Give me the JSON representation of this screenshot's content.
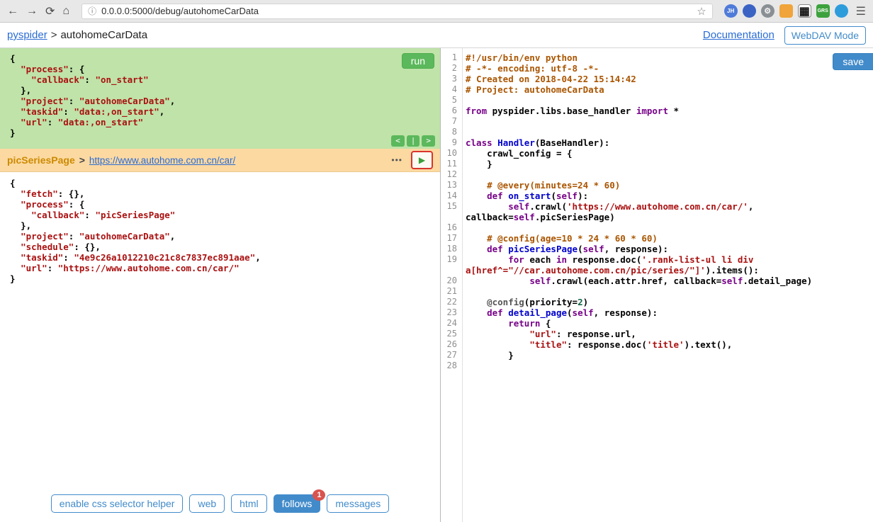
{
  "colors": {
    "accent": "#428bca",
    "link": "#2a6cd5",
    "run": "#5cb85c",
    "badge": "#d9534f",
    "play_border": "#d9342c",
    "play_fill": "#3c9e3c",
    "task_bg": "#bfe3a9",
    "follow_bg": "#fcd9a1",
    "follow_fg": "#cc8a00",
    "syn_comment": "#aa5500",
    "syn_keyword": "#770088",
    "syn_def": "#0000cc",
    "syn_string": "#aa1111",
    "syn_number": "#116644",
    "syn_meta": "#555555"
  },
  "browser": {
    "icons": {
      "back": "←",
      "forward": "→",
      "refresh": "⟳",
      "home": "⌂",
      "info": "ⓘ",
      "star": "☆",
      "menu": "☰"
    },
    "url": "0.0.0.0:5000/debug/autohomeCarData",
    "extensions": [
      {
        "name": "jh",
        "label": "JH",
        "color": "#4f7bd9",
        "shape": "circle"
      },
      {
        "name": "blue-app",
        "label": "",
        "color": "#3b63c4",
        "shape": "circle"
      },
      {
        "name": "gear",
        "label": "⚙",
        "color": "#8a8f94",
        "fg": "#f2f2f2",
        "size": "11px",
        "shape": "circle"
      },
      {
        "name": "orange-app",
        "label": "",
        "color": "#f0a43b",
        "shape": "square"
      },
      {
        "name": "qr-code",
        "label": "▦",
        "color": "#ffffff",
        "fg": "#111111",
        "size": "16px",
        "border": "1px solid #888",
        "shape": "square"
      },
      {
        "name": "grs",
        "label": "GRS",
        "color": "#3da23d",
        "size": "7px",
        "shape": "square"
      },
      {
        "name": "globe",
        "label": "",
        "color": "#2d9cdb",
        "shape": "circle"
      }
    ]
  },
  "header": {
    "app": "pyspider",
    "separator": ">",
    "project": "autohomeCarData",
    "documentation": "Documentation",
    "webdav": "WebDAV Mode"
  },
  "left": {
    "run_label": "run",
    "nav": [
      "<",
      "|",
      ">"
    ],
    "task_json": [
      [
        [
          "p",
          "{"
        ]
      ],
      [
        [
          "p",
          "  "
        ],
        [
          "s",
          "\"process\""
        ],
        [
          "p",
          ": {"
        ]
      ],
      [
        [
          "p",
          "    "
        ],
        [
          "s",
          "\"callback\""
        ],
        [
          "p",
          ": "
        ],
        [
          "s",
          "\"on_start\""
        ]
      ],
      [
        [
          "p",
          "  },"
        ]
      ],
      [
        [
          "p",
          "  "
        ],
        [
          "s",
          "\"project\""
        ],
        [
          "p",
          ": "
        ],
        [
          "s",
          "\"autohomeCarData\""
        ],
        [
          "p",
          ","
        ]
      ],
      [
        [
          "p",
          "  "
        ],
        [
          "s",
          "\"taskid\""
        ],
        [
          "p",
          ": "
        ],
        [
          "s",
          "\"data:,on_start\""
        ],
        [
          "p",
          ","
        ]
      ],
      [
        [
          "p",
          "  "
        ],
        [
          "s",
          "\"url\""
        ],
        [
          "p",
          ": "
        ],
        [
          "s",
          "\"data:,on_start\""
        ]
      ],
      [
        [
          "p",
          "}"
        ]
      ]
    ],
    "follow": {
      "callback": "picSeriesPage",
      "separator": ">",
      "url": "https://www.autohome.com.cn/car/",
      "more_label": "•••",
      "play_icon": "▶"
    },
    "detail_json": [
      [
        [
          "p",
          "{"
        ]
      ],
      [
        [
          "p",
          "  "
        ],
        [
          "s",
          "\"fetch\""
        ],
        [
          "p",
          ": {},"
        ]
      ],
      [
        [
          "p",
          "  "
        ],
        [
          "s",
          "\"process\""
        ],
        [
          "p",
          ": {"
        ]
      ],
      [
        [
          "p",
          "    "
        ],
        [
          "s",
          "\"callback\""
        ],
        [
          "p",
          ": "
        ],
        [
          "s",
          "\"picSeriesPage\""
        ]
      ],
      [
        [
          "p",
          "  },"
        ]
      ],
      [
        [
          "p",
          "  "
        ],
        [
          "s",
          "\"project\""
        ],
        [
          "p",
          ": "
        ],
        [
          "s",
          "\"autohomeCarData\""
        ],
        [
          "p",
          ","
        ]
      ],
      [
        [
          "p",
          "  "
        ],
        [
          "s",
          "\"schedule\""
        ],
        [
          "p",
          ": {},"
        ]
      ],
      [
        [
          "p",
          "  "
        ],
        [
          "s",
          "\"taskid\""
        ],
        [
          "p",
          ": "
        ],
        [
          "s",
          "\"4e9c26a1012210c21c8c7837ec891aae\""
        ],
        [
          "p",
          ","
        ]
      ],
      [
        [
          "p",
          "  "
        ],
        [
          "s",
          "\"url\""
        ],
        [
          "p",
          ": "
        ],
        [
          "s",
          "\"https://www.autohome.com.cn/car/\""
        ]
      ],
      [
        [
          "p",
          "}"
        ]
      ]
    ],
    "tabs": [
      {
        "name": "css-selector-helper",
        "label": "enable css selector helper"
      },
      {
        "name": "web",
        "label": "web"
      },
      {
        "name": "html",
        "label": "html"
      },
      {
        "name": "follows",
        "label": "follows",
        "active": true,
        "badge": "1"
      },
      {
        "name": "messages",
        "label": "messages"
      }
    ]
  },
  "editor": {
    "save_label": "save",
    "lines": [
      {
        "n": 1,
        "t": [
          [
            "c",
            "#!/usr/bin/env python"
          ]
        ]
      },
      {
        "n": 2,
        "t": [
          [
            "c",
            "# -*- encoding: utf-8 -*-"
          ]
        ]
      },
      {
        "n": 3,
        "t": [
          [
            "c",
            "# Created on 2018-04-22 15:14:42"
          ]
        ]
      },
      {
        "n": 4,
        "t": [
          [
            "c",
            "# Project: autohomeCarData"
          ]
        ]
      },
      {
        "n": 5,
        "t": []
      },
      {
        "n": 6,
        "t": [
          [
            "k",
            "from"
          ],
          [
            "p",
            " pyspider.libs.base_handler "
          ],
          [
            "k",
            "import"
          ],
          [
            "p",
            " *"
          ]
        ]
      },
      {
        "n": 7,
        "t": []
      },
      {
        "n": 8,
        "t": []
      },
      {
        "n": 9,
        "t": [
          [
            "k",
            "class"
          ],
          [
            "p",
            " "
          ],
          [
            "d",
            "Handler"
          ],
          [
            "p",
            "(BaseHandler):"
          ]
        ]
      },
      {
        "n": 10,
        "t": [
          [
            "p",
            "    crawl_config = {"
          ]
        ]
      },
      {
        "n": 11,
        "t": [
          [
            "p",
            "    }"
          ]
        ]
      },
      {
        "n": 12,
        "t": []
      },
      {
        "n": 13,
        "t": [
          [
            "c",
            "    # @every(minutes=24 * 60)"
          ]
        ]
      },
      {
        "n": 14,
        "t": [
          [
            "p",
            "    "
          ],
          [
            "k",
            "def"
          ],
          [
            "p",
            " "
          ],
          [
            "d",
            "on_start"
          ],
          [
            "p",
            "("
          ],
          [
            "k",
            "self"
          ],
          [
            "p",
            "):"
          ]
        ]
      },
      {
        "n": 15,
        "t": [
          [
            "p",
            "        "
          ],
          [
            "k",
            "self"
          ],
          [
            "p",
            ".crawl("
          ],
          [
            "s",
            "'https://www.autohome.com.cn/car/'"
          ],
          [
            "p",
            ", callback="
          ],
          [
            "k",
            "self"
          ],
          [
            "p",
            ".picSeriesPage)"
          ]
        ]
      },
      {
        "n": 16,
        "t": []
      },
      {
        "n": 17,
        "t": [
          [
            "c",
            "    # @config(age=10 * 24 * 60 * 60)"
          ]
        ]
      },
      {
        "n": 18,
        "t": [
          [
            "p",
            "    "
          ],
          [
            "k",
            "def"
          ],
          [
            "p",
            " "
          ],
          [
            "d",
            "picSeriesPage"
          ],
          [
            "p",
            "("
          ],
          [
            "k",
            "self"
          ],
          [
            "p",
            ", response):"
          ]
        ]
      },
      {
        "n": 19,
        "t": [
          [
            "p",
            "        "
          ],
          [
            "k",
            "for"
          ],
          [
            "p",
            " each "
          ],
          [
            "k",
            "in"
          ],
          [
            "p",
            " response.doc("
          ],
          [
            "s",
            "'.rank-list-ul li div a[href^=\"//car.autohome.com.cn/pic/series/\"]'"
          ],
          [
            "p",
            ").items():"
          ]
        ]
      },
      {
        "n": 20,
        "t": [
          [
            "p",
            "            "
          ],
          [
            "k",
            "self"
          ],
          [
            "p",
            ".crawl(each.attr.href, callback="
          ],
          [
            "k",
            "self"
          ],
          [
            "p",
            ".detail_page)"
          ]
        ]
      },
      {
        "n": 21,
        "t": []
      },
      {
        "n": 22,
        "t": [
          [
            "p",
            "    "
          ],
          [
            "m",
            "@config"
          ],
          [
            "p",
            "(priority="
          ],
          [
            "n",
            "2"
          ],
          [
            "p",
            ")"
          ]
        ]
      },
      {
        "n": 23,
        "t": [
          [
            "p",
            "    "
          ],
          [
            "k",
            "def"
          ],
          [
            "p",
            " "
          ],
          [
            "d",
            "detail_page"
          ],
          [
            "p",
            "("
          ],
          [
            "k",
            "self"
          ],
          [
            "p",
            ", response):"
          ]
        ]
      },
      {
        "n": 24,
        "t": [
          [
            "p",
            "        "
          ],
          [
            "k",
            "return"
          ],
          [
            "p",
            " {"
          ]
        ]
      },
      {
        "n": 25,
        "t": [
          [
            "p",
            "            "
          ],
          [
            "s",
            "\"url\""
          ],
          [
            "p",
            ": response.url,"
          ]
        ]
      },
      {
        "n": 26,
        "t": [
          [
            "p",
            "            "
          ],
          [
            "s",
            "\"title\""
          ],
          [
            "p",
            ": response.doc("
          ],
          [
            "s",
            "'title'"
          ],
          [
            "p",
            ").text(),"
          ]
        ]
      },
      {
        "n": 27,
        "t": [
          [
            "p",
            "        }"
          ]
        ]
      },
      {
        "n": 28,
        "t": []
      }
    ]
  }
}
